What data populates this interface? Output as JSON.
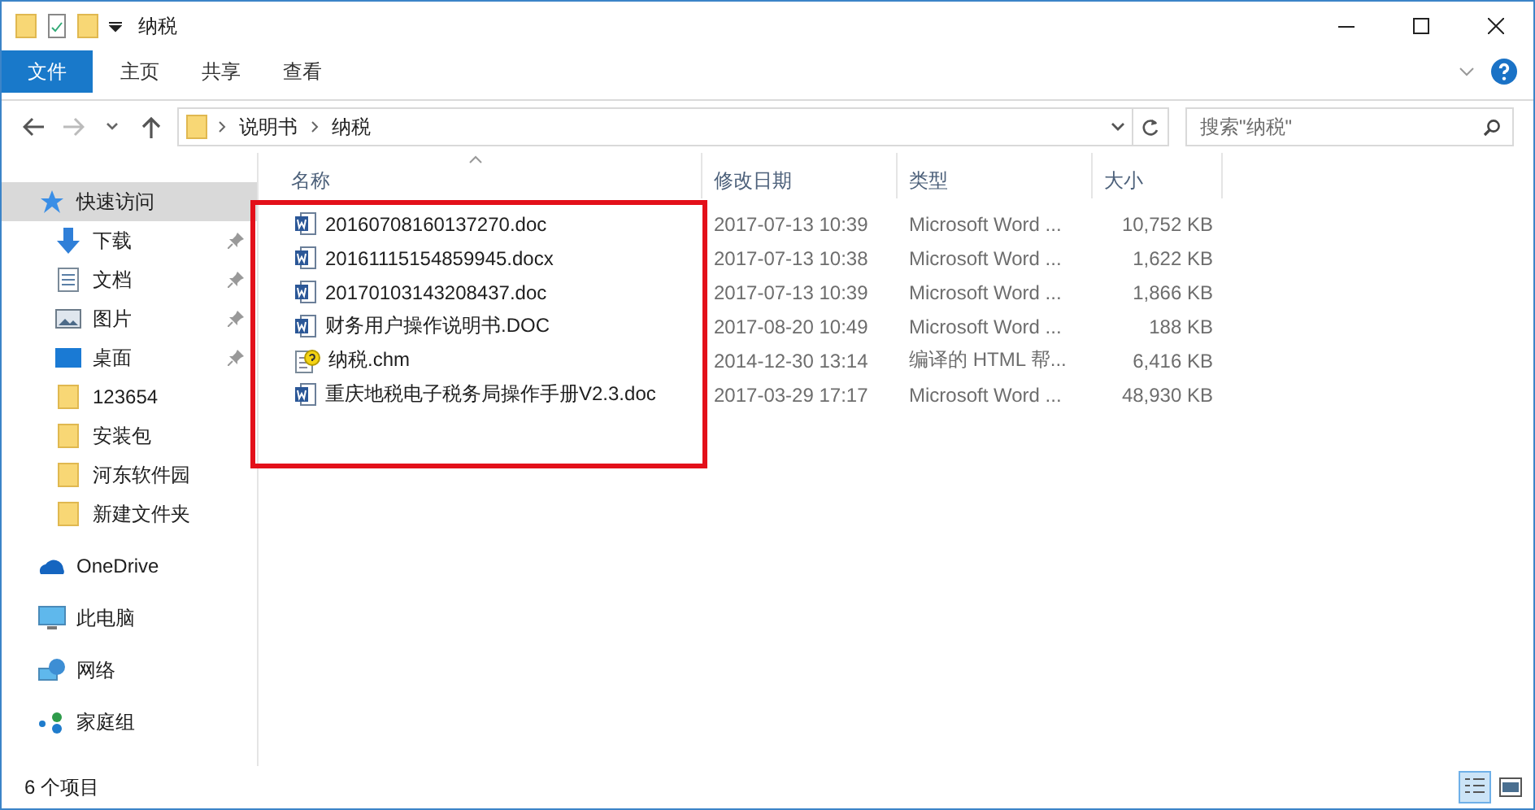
{
  "window": {
    "title": "纳税"
  },
  "ribbon": {
    "tabs": [
      {
        "label": "文件",
        "kind": "file"
      },
      {
        "label": "主页",
        "kind": "tab"
      },
      {
        "label": "共享",
        "kind": "tab"
      },
      {
        "label": "查看",
        "kind": "tab"
      }
    ]
  },
  "address": {
    "path": [
      "说明书",
      "纳税"
    ],
    "search_placeholder": "搜索\"纳税\""
  },
  "sidebar": {
    "items": [
      {
        "label": "快速访问",
        "kind": "star",
        "selected": true,
        "children": [
          {
            "label": "下载",
            "kind": "download",
            "pinned": true,
            "selected": false
          },
          {
            "label": "文档",
            "kind": "document",
            "pinned": true,
            "selected": false
          },
          {
            "label": "图片",
            "kind": "pictures",
            "pinned": true,
            "selected": false
          },
          {
            "label": "桌面",
            "kind": "desktop",
            "pinned": true,
            "selected": false
          },
          {
            "label": "123654",
            "kind": "folder",
            "pinned": false,
            "selected": false
          },
          {
            "label": "安装包",
            "kind": "folder",
            "pinned": false,
            "selected": false
          },
          {
            "label": "河东软件园",
            "kind": "folder",
            "pinned": false,
            "selected": false
          },
          {
            "label": "新建文件夹",
            "kind": "folder",
            "pinned": false,
            "selected": false
          }
        ]
      },
      {
        "label": "OneDrive",
        "kind": "cloud",
        "selected": false
      },
      {
        "label": "此电脑",
        "kind": "computer",
        "selected": false
      },
      {
        "label": "网络",
        "kind": "network",
        "selected": false
      },
      {
        "label": "家庭组",
        "kind": "homegroup",
        "selected": false
      }
    ]
  },
  "table": {
    "columns": [
      {
        "label": "名称",
        "sorted": true
      },
      {
        "label": "修改日期",
        "sorted": false
      },
      {
        "label": "类型",
        "sorted": false
      },
      {
        "label": "大小",
        "sorted": false
      }
    ],
    "rows": [
      {
        "kind": "word",
        "name": "20160708160137270.doc",
        "modified": "2017-07-13 10:39",
        "type": "Microsoft Word ...",
        "size": "10,752 KB"
      },
      {
        "kind": "word",
        "name": "20161115154859945.docx",
        "modified": "2017-07-13 10:38",
        "type": "Microsoft Word ...",
        "size": "1,622 KB"
      },
      {
        "kind": "word",
        "name": "20170103143208437.doc",
        "modified": "2017-07-13 10:39",
        "type": "Microsoft Word ...",
        "size": "1,866 KB"
      },
      {
        "kind": "word",
        "name": "财务用户操作说明书.DOC",
        "modified": "2017-08-20 10:49",
        "type": "Microsoft Word ...",
        "size": "188 KB"
      },
      {
        "kind": "help",
        "name": "纳税.chm",
        "modified": "2014-12-30 13:14",
        "type": "编译的 HTML 帮...",
        "size": "6,416 KB"
      },
      {
        "kind": "word",
        "name": "重庆地税电子税务局操作手册V2.3.doc",
        "modified": "2017-03-29 17:17",
        "type": "Microsoft Word ...",
        "size": "48,930 KB"
      }
    ]
  },
  "annotation": {
    "kind": "frame"
  },
  "status_bar": {
    "count": "6 个项目",
    "views": [
      {
        "kind": "details",
        "selected": true
      },
      {
        "kind": "thumbnails",
        "selected": false
      }
    ]
  }
}
